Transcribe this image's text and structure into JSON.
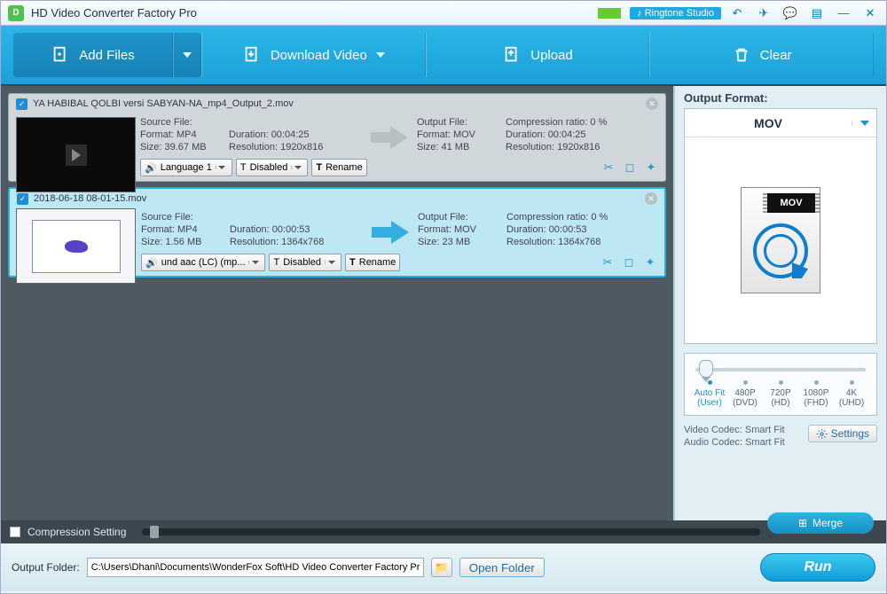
{
  "app": {
    "title": "HD Video Converter Factory Pro",
    "ringtone": "Ringtone Studio"
  },
  "toolbar": {
    "add": "Add Files",
    "download": "Download Video",
    "upload": "Upload",
    "clear": "Clear"
  },
  "files": [
    {
      "name": "YA HABIBAL QOLBI versi SABYAN-NA_mp4_Output_2.mov",
      "src": {
        "label": "Source File:",
        "format": "Format: MP4",
        "size": "Size: 39.67 MB",
        "duration": "Duration: 00:04:25",
        "resolution": "Resolution: 1920x816"
      },
      "out": {
        "label": "Output File:",
        "format": "Format: MOV",
        "size": "Size: 41 MB",
        "compression": "Compression ratio: 0 %",
        "duration": "Duration: 00:04:25",
        "resolution": "Resolution: 1920x816"
      },
      "lang": "Language 1",
      "sub": "Disabled",
      "rename": "Rename"
    },
    {
      "name": "2018-06-18 08-01-15.mov",
      "src": {
        "label": "Source File:",
        "format": "Format: MP4",
        "size": "Size: 1.56 MB",
        "duration": "Duration: 00:00:53",
        "resolution": "Resolution: 1364x768"
      },
      "out": {
        "label": "Output File:",
        "format": "Format: MOV",
        "size": "Size: 23 MB",
        "compression": "Compression ratio: 0 %",
        "duration": "Duration: 00:00:53",
        "resolution": "Resolution: 1364x768"
      },
      "lang": "und aac (LC) (mp...",
      "sub": "Disabled",
      "rename": "Rename"
    }
  ],
  "side": {
    "output_label": "Output Format:",
    "format": "MOV",
    "mov_text": "MOV",
    "reso": [
      {
        "top": "Auto Fit",
        "bot": "(User)"
      },
      {
        "top": "480P",
        "bot": "(DVD)"
      },
      {
        "top": "720P",
        "bot": "(HD)"
      },
      {
        "top": "1080P",
        "bot": "(FHD)"
      },
      {
        "top": "4K",
        "bot": "(UHD)"
      }
    ],
    "vcodec": "Video Codec: Smart Fit",
    "acodec": "Audio Codec: Smart Fit",
    "settings": "Settings"
  },
  "status": {
    "compression": "Compression Setting",
    "merge": "Merge"
  },
  "bottom": {
    "folder_label": "Output Folder:",
    "path": "C:\\Users\\Dhani\\Documents\\WonderFox Soft\\HD Video Converter Factory Pro",
    "open": "Open Folder",
    "run": "Run"
  }
}
